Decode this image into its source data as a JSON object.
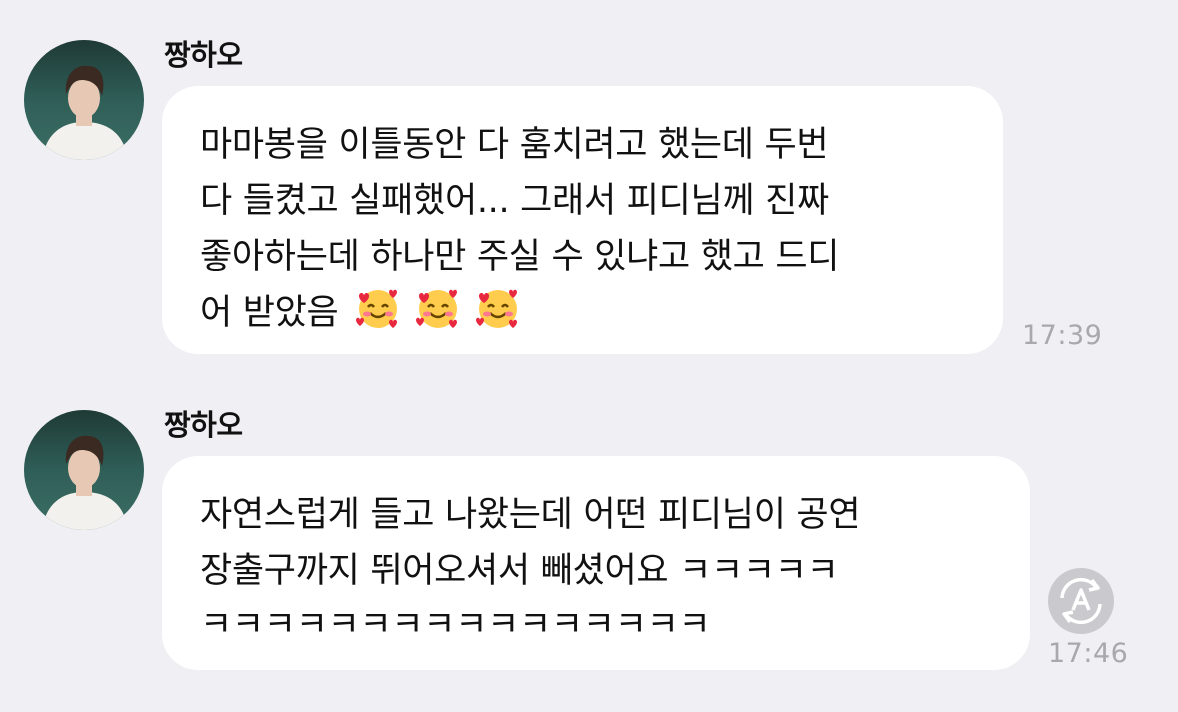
{
  "messages": [
    {
      "sender": "짱하오",
      "avatar_icon": "profile-photo",
      "lines": [
        "마마봉을 이틀동안 다 훔치려고 했는데 두번",
        "다 들켰고 실패했어... 그래서 피디님께 진짜",
        "좋아하는데 하나만 주실 수 있냐고 했고 드디",
        "어 받았음"
      ],
      "emoji": [
        "🥰",
        "🥰",
        "🥰"
      ],
      "time": "17:39"
    },
    {
      "sender": "짱하오",
      "avatar_icon": "profile-photo",
      "lines": [
        "자연스럽게 들고 나왔는데 어떤 피디님이 공연",
        "장출구까지 뛰어오셔서 빼셨어요 ㅋㅋㅋㅋㅋ",
        "ㅋㅋㅋㅋㅋㅋㅋㅋㅋㅋㅋㅋㅋㅋㅋㅋ"
      ],
      "time": "17:46",
      "translate_icon": "translate-icon"
    }
  ]
}
